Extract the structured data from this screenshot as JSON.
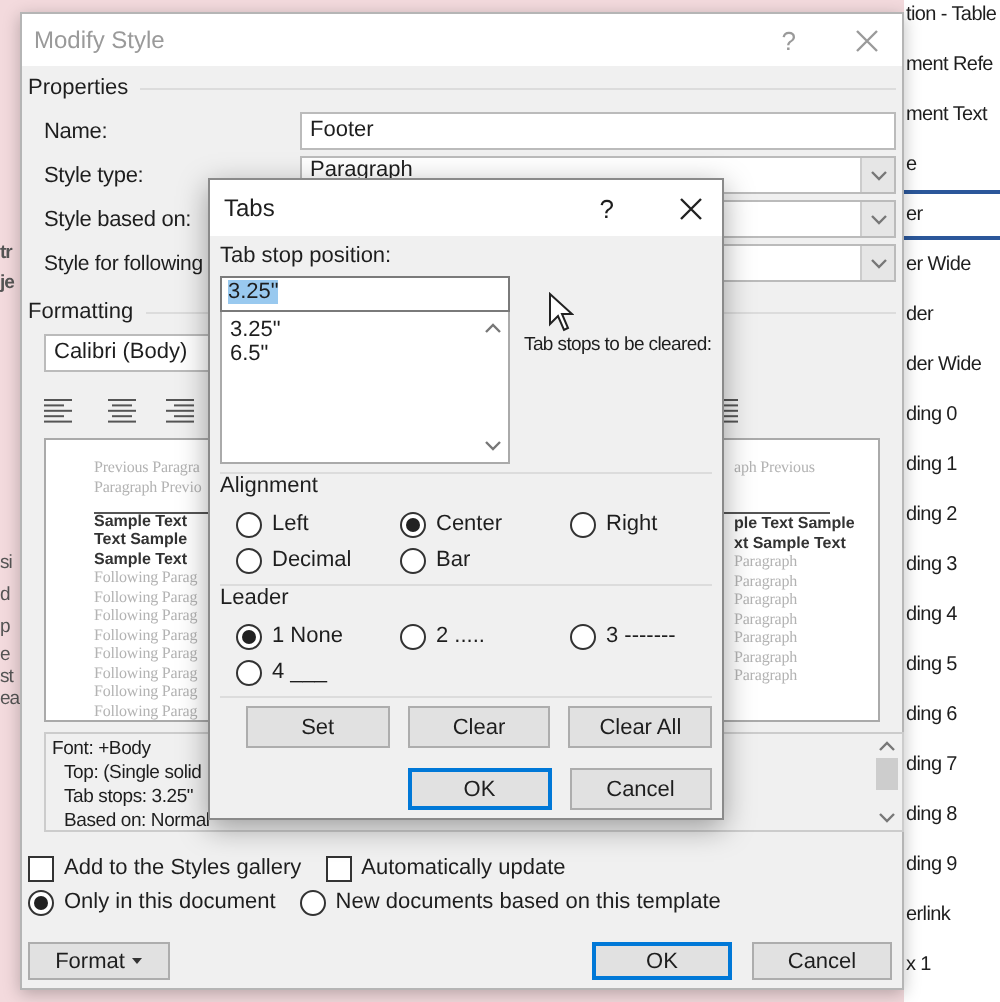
{
  "document_fragments": [
    {
      "kind": "bold",
      "lines": [
        "tr",
        "je"
      ]
    },
    {
      "kind": "plain",
      "lines": [
        "si",
        "d",
        "p"
      ]
    },
    {
      "kind": "plain",
      "lines": [
        "e",
        "st",
        "ea"
      ]
    }
  ],
  "styles_pane": {
    "items": [
      {
        "label": "tion - Table",
        "selected": false
      },
      {
        "label": "ment Refe",
        "selected": false
      },
      {
        "label": "ment Text",
        "selected": false
      },
      {
        "label": "e",
        "selected": false
      },
      {
        "label": "er",
        "selected": true
      },
      {
        "label": "er Wide",
        "selected": false
      },
      {
        "label": "der",
        "selected": false
      },
      {
        "label": "der Wide",
        "selected": false
      },
      {
        "label": "ding 0",
        "selected": false
      },
      {
        "label": "ding 1",
        "selected": false
      },
      {
        "label": "ding 2",
        "selected": false
      },
      {
        "label": "ding 3",
        "selected": false
      },
      {
        "label": "ding 4",
        "selected": false
      },
      {
        "label": "ding 5",
        "selected": false
      },
      {
        "label": "ding 6",
        "selected": false
      },
      {
        "label": "ding 7",
        "selected": false
      },
      {
        "label": "ding 8",
        "selected": false
      },
      {
        "label": "ding 9",
        "selected": false
      },
      {
        "label": "erlink",
        "selected": false
      },
      {
        "label": "x 1",
        "selected": false
      }
    ]
  },
  "modify_style": {
    "title": "Modify Style",
    "help": "?",
    "active": false,
    "properties": {
      "heading": "Properties",
      "rows": [
        {
          "kind": "text",
          "label": "Name:",
          "value": "Footer"
        },
        {
          "kind": "dropdown",
          "label": "Style type:",
          "value": "Paragraph"
        },
        {
          "kind": "dropdown",
          "label": "Style based on:"
        },
        {
          "kind": "dropdown",
          "label": "Style for following"
        }
      ]
    },
    "formatting": {
      "heading": "Formatting",
      "font": "Calibri (Body)",
      "preview": {
        "left": {
          "previous": [
            "Previous Paragra",
            "Paragraph Previo"
          ],
          "sample": [
            "Sample Text",
            "Text Sample",
            "Sample Text"
          ],
          "following": [
            "Following Parag",
            "Following Parag",
            "Following Parag",
            "Following Parag",
            "Following Parag",
            "Following Parag",
            "Following Parag",
            "Following Parag"
          ]
        },
        "right": {
          "previous": [
            "aph Previous"
          ],
          "sample": [
            "ple Text Sample",
            "xt Sample Text"
          ],
          "following": [
            "Paragraph",
            "Paragraph",
            "Paragraph",
            "Paragraph",
            "Paragraph",
            "Paragraph",
            "Paragraph"
          ]
        }
      },
      "description": [
        "Font: +Body",
        "Top: (Single solid",
        "Tab stops: 3.25\"",
        "Based on: Normal"
      ]
    },
    "checkboxes": [
      {
        "label": "Add to the Styles gallery",
        "checked": false
      },
      {
        "label": "Automatically update",
        "checked": false
      }
    ],
    "radios": [
      {
        "label": "Only in this document",
        "selected": true
      },
      {
        "label": "New documents based on this template",
        "selected": false
      }
    ],
    "buttons": [
      {
        "kind": "menu",
        "label": "Format",
        "default": false
      },
      {
        "kind": "plain",
        "label": "OK",
        "default": true
      },
      {
        "kind": "plain",
        "label": "Cancel",
        "default": false
      }
    ]
  },
  "tabs_dialog": {
    "title": "Tabs",
    "help": "?",
    "tab_stop_position": {
      "label": "Tab stop position:",
      "value": "3.25\"",
      "text_selected": true,
      "list": [
        "3.25\"",
        "6.5\""
      ]
    },
    "cleared_label": "Tab stops to be cleared:",
    "alignment": {
      "heading": "Alignment",
      "options": [
        {
          "label": "Left",
          "selected": false
        },
        {
          "label": "Center",
          "selected": true
        },
        {
          "label": "Right",
          "selected": false
        },
        {
          "label": "Decimal",
          "selected": false
        },
        {
          "label": "Bar",
          "selected": false
        }
      ]
    },
    "leader": {
      "heading": "Leader",
      "options": [
        {
          "label": "1 None",
          "selected": true
        },
        {
          "label": "2 .....",
          "selected": false
        },
        {
          "label": "3 -------",
          "selected": false
        },
        {
          "label": "4 ___",
          "selected": false
        }
      ]
    },
    "buttons": [
      {
        "label": "Set",
        "default": false
      },
      {
        "label": "Clear",
        "default": false
      },
      {
        "label": "Clear All",
        "default": false
      },
      {
        "label": "OK",
        "default": true
      },
      {
        "label": "Cancel",
        "default": false
      }
    ]
  }
}
